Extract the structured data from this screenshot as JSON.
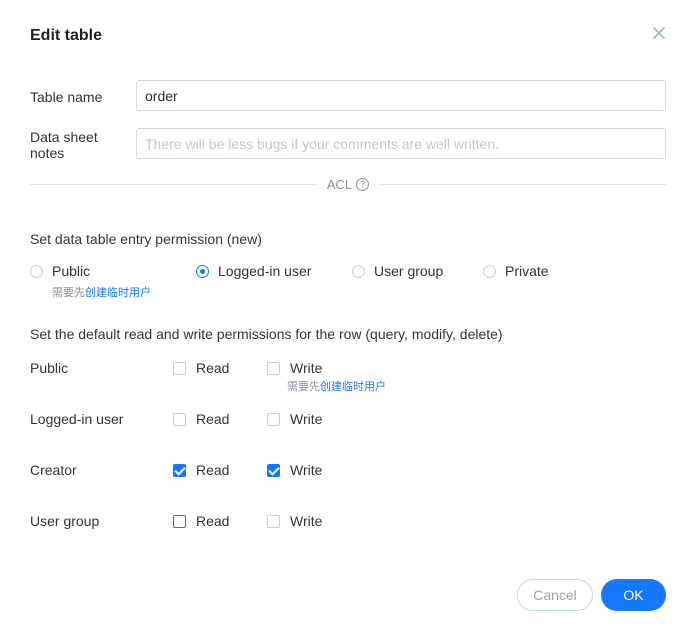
{
  "dialog": {
    "title": "Edit table",
    "close_icon": "close-icon"
  },
  "fields": {
    "table_name_label": "Table name",
    "table_name_value": "order",
    "notes_label_line1": "Data sheet",
    "notes_label_line2": "notes",
    "notes_placeholder": "There will be less bugs if your comments are well written."
  },
  "acl": {
    "divider_label": "ACL",
    "help_icon": "question-circle-icon",
    "help_glyph": "?"
  },
  "entry_permission": {
    "heading": "Set data table entry permission (new)",
    "options": [
      {
        "label": "Public",
        "checked": false
      },
      {
        "label": "Logged-in user",
        "checked": true
      },
      {
        "label": "User group",
        "checked": false
      },
      {
        "label": "Private",
        "checked": false
      }
    ],
    "hint_prefix": "需要先",
    "hint_link": "创建临时用户"
  },
  "row_permission": {
    "heading": "Set the default read and write permissions for the row (query, modify, delete)",
    "read_label": "Read",
    "write_label": "Write",
    "rows": [
      {
        "label": "Public",
        "read": false,
        "write": false
      },
      {
        "label": "Logged-in user",
        "read": false,
        "write": false
      },
      {
        "label": "Creator",
        "read": true,
        "write": true
      },
      {
        "label": "User group",
        "read": false,
        "write": false
      }
    ],
    "hint_prefix": "需要先",
    "hint_link": "创建临时用户"
  },
  "footer": {
    "cancel_label": "Cancel",
    "ok_label": "OK"
  },
  "colors": {
    "accent": "#1677ff"
  }
}
